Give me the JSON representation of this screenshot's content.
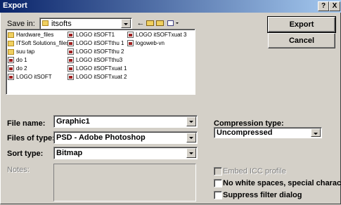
{
  "window": {
    "title": "Export",
    "help_label": "?",
    "close_label": "X"
  },
  "save_in": {
    "label": "Save in:",
    "value": "itsofts"
  },
  "files": [
    {
      "name": "Hardware_files",
      "kind": "folder"
    },
    {
      "name": "ITSoft Solutions_files",
      "kind": "folder"
    },
    {
      "name": "suu tap",
      "kind": "folder"
    },
    {
      "name": "do 1",
      "kind": "file"
    },
    {
      "name": "do 2",
      "kind": "file"
    },
    {
      "name": "LOGO itSOFT",
      "kind": "file"
    },
    {
      "name": "LOGO itSOFT1",
      "kind": "file"
    },
    {
      "name": "LOGO itSOFTthu 1",
      "kind": "file"
    },
    {
      "name": "LOGO itSOFTthu 2",
      "kind": "file"
    },
    {
      "name": "LOGO itSOFTthu3",
      "kind": "file"
    },
    {
      "name": "LOGO itSOFTxuat 1",
      "kind": "file"
    },
    {
      "name": "LOGO itSOFTxuat 2",
      "kind": "file"
    },
    {
      "name": "LOGO itSOFTxuat 3",
      "kind": "file"
    },
    {
      "name": "logoweb-vn",
      "kind": "file"
    }
  ],
  "form": {
    "file_name_label": "File name:",
    "file_name_value": "Graphic1",
    "files_of_type_label": "Files of type:",
    "files_of_type_value": "PSD - Adobe Photoshop",
    "sort_type_label": "Sort type:",
    "sort_type_value": "Bitmap",
    "notes_label": "Notes:",
    "notes_value": ""
  },
  "compression": {
    "label": "Compression type:",
    "value": "Uncompressed"
  },
  "buttons": {
    "export": "Export",
    "cancel": "Cancel"
  },
  "options": {
    "embed_icc": {
      "label": "Embed ICC profile",
      "checked": false,
      "enabled": false
    },
    "no_white_spaces": {
      "label": "No white spaces, special characters",
      "checked": false,
      "enabled": true
    },
    "suppress_filter": {
      "label": "Suppress filter dialog",
      "checked": false,
      "enabled": true
    }
  },
  "colors": {
    "face": "#d4d0c8",
    "titlebar_start": "#0a246a",
    "titlebar_end": "#a6caf0"
  }
}
